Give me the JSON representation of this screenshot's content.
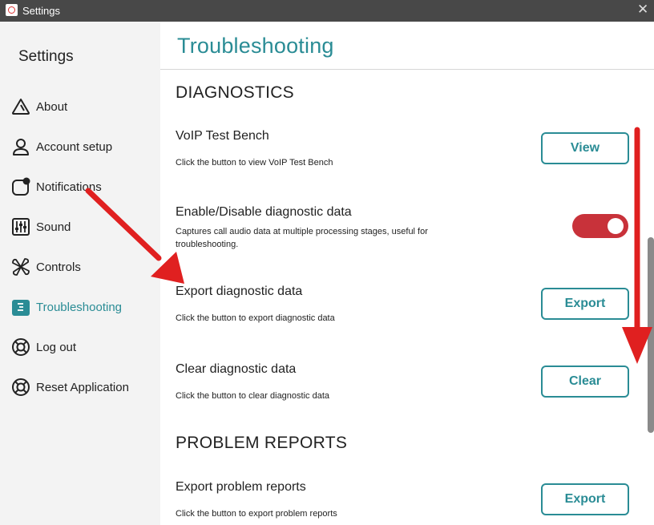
{
  "window": {
    "title": "Settings"
  },
  "sidebar": {
    "heading": "Settings",
    "items": [
      {
        "label": "About",
        "icon": "warning-triangle-icon"
      },
      {
        "label": "Account setup",
        "icon": "user-icon"
      },
      {
        "label": "Notifications",
        "icon": "notification-icon"
      },
      {
        "label": "Sound",
        "icon": "equalizer-icon"
      },
      {
        "label": "Controls",
        "icon": "controls-icon"
      },
      {
        "label": "Troubleshooting",
        "icon": "troubleshooting-icon",
        "active": true
      },
      {
        "label": "Log out",
        "icon": "lifebuoy-icon"
      },
      {
        "label": "Reset Application",
        "icon": "lifebuoy-icon"
      }
    ]
  },
  "main": {
    "title": "Troubleshooting",
    "diagnostics": {
      "heading": "DIAGNOSTICS",
      "voip": {
        "title": "VoIP Test Bench",
        "desc": "Click the button to view VoIP Test Bench",
        "button": "View"
      },
      "enable": {
        "title": "Enable/Disable diagnostic data",
        "desc": "Captures call audio data at multiple processing stages, useful for troubleshooting.",
        "enabled": true
      },
      "export": {
        "title": "Export diagnostic data",
        "desc": "Click the button to export diagnostic data",
        "button": "Export"
      },
      "clear": {
        "title": "Clear diagnostic data",
        "desc": "Click the button to clear diagnostic data",
        "button": "Clear"
      }
    },
    "problem_reports": {
      "heading": "PROBLEM REPORTS",
      "export": {
        "title": "Export problem reports",
        "desc": "Click the button to export problem reports",
        "button": "Export"
      }
    }
  },
  "colors": {
    "accent": "#2a8c95",
    "toggle_on": "#c8323a",
    "annotation_arrow": "#e02020",
    "titlebar": "#484848",
    "sidebar_bg": "#f3f3f3"
  }
}
